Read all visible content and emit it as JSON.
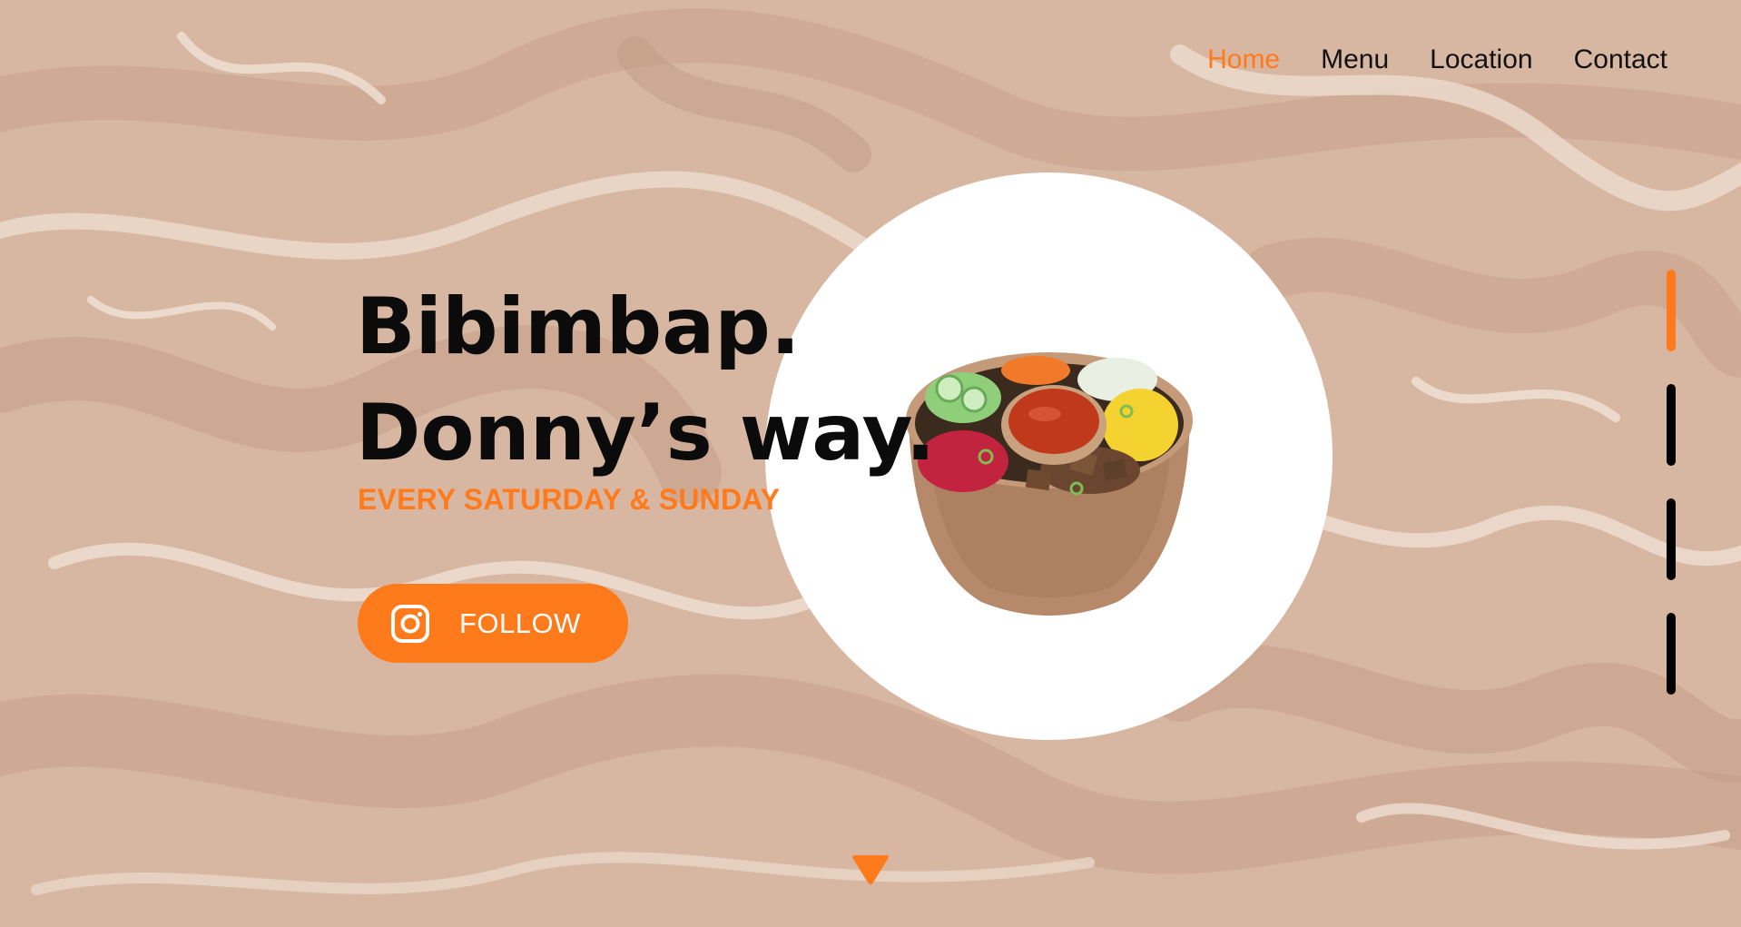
{
  "nav": {
    "items": [
      {
        "label": "Home",
        "active": true
      },
      {
        "label": "Menu",
        "active": false
      },
      {
        "label": "Location",
        "active": false
      },
      {
        "label": "Contact",
        "active": false
      }
    ]
  },
  "hero": {
    "title_line1": "Bibimbap.",
    "title_line2": "Donny’s way.",
    "subtitle": "EVERY SATURDAY & SUNDAY"
  },
  "follow_button": {
    "label": "FOLLOW",
    "icon": "instagram-icon"
  },
  "slides": {
    "count": 4,
    "active_index": 0
  },
  "scroll_down": {
    "icon": "triangle-down-icon"
  },
  "colors": {
    "accent": "#ff7a1a",
    "background": "#d9b8a3",
    "text": "#111111",
    "circle": "#ffffff"
  }
}
